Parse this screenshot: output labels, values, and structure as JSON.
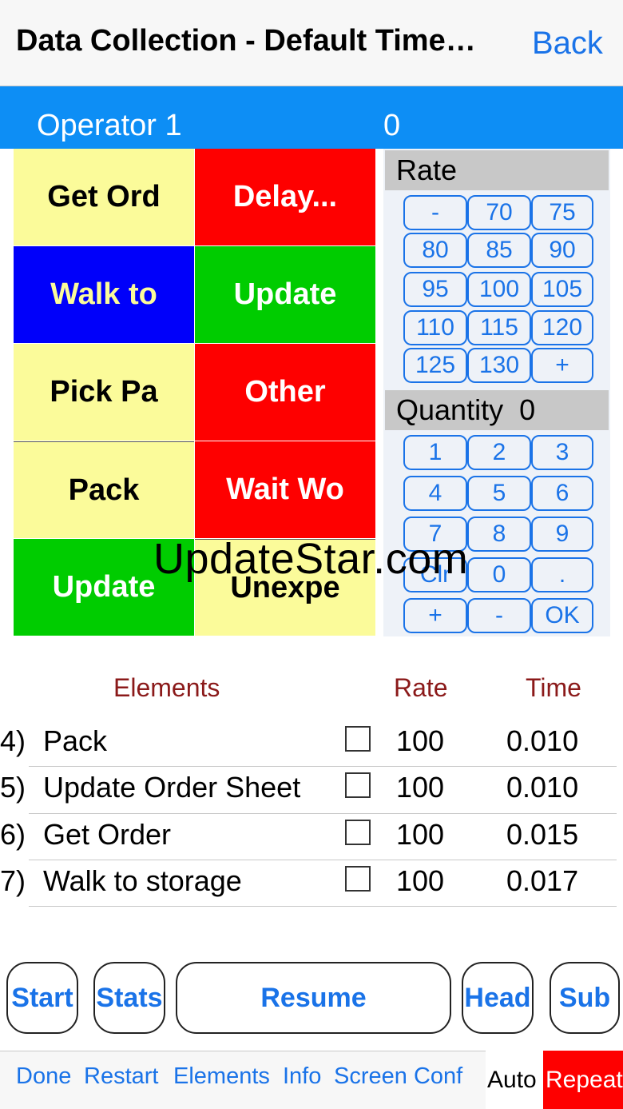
{
  "nav": {
    "title": "Data Collection - Default Time…",
    "back_label": "Back"
  },
  "operator": {
    "name": "Operator 1",
    "count": "0"
  },
  "elements_grid": [
    "Get Ord",
    "Delay...",
    "Walk to",
    "Update",
    "Pick Pa",
    "Other",
    "Pack",
    "Wait Wo",
    "Update",
    "Unexpe"
  ],
  "rate_panel": {
    "title": "Rate",
    "keys": [
      "-",
      "70",
      "75",
      "80",
      "85",
      "90",
      "95",
      "100",
      "105",
      "110",
      "115",
      "120",
      "125",
      "130",
      "+"
    ]
  },
  "quantity_panel": {
    "title": "Quantity",
    "value": "0",
    "keys": [
      "1",
      "2",
      "3",
      "4",
      "5",
      "6",
      "7",
      "8",
      "9",
      "Clr",
      "0",
      ".",
      "+",
      "-",
      "OK"
    ]
  },
  "watermark": "UpdateStar.com",
  "table": {
    "headers": {
      "elements": "Elements",
      "rate": "Rate",
      "time": "Time"
    },
    "rows": [
      {
        "num": "4)",
        "name": "Pack",
        "rate": "100",
        "time": "0.010"
      },
      {
        "num": "5)",
        "name": "Update Order Sheet",
        "rate": "100",
        "time": "0.010"
      },
      {
        "num": "6)",
        "name": "Get Order",
        "rate": "100",
        "time": "0.015"
      },
      {
        "num": "7)",
        "name": "Walk to storage",
        "rate": "100",
        "time": "0.017"
      }
    ]
  },
  "buttons": {
    "start": "Start",
    "stats": "Stats",
    "resume": "Resume",
    "head": "Head",
    "sub": "Sub"
  },
  "toolbar": {
    "done": "Done",
    "restart": "Restart",
    "elements": "Elements",
    "info": "Info",
    "screen_conf": "Screen Conf",
    "auto": "Auto",
    "repeat": "Repeat"
  },
  "colors": {
    "accent": "#1a73e8",
    "operator_bar": "#0d8ef5",
    "yellow": "#fbfb9a",
    "red": "#fe0000",
    "blue": "#0000fa",
    "green": "#00cc00",
    "header_text": "#8b1a1a"
  }
}
